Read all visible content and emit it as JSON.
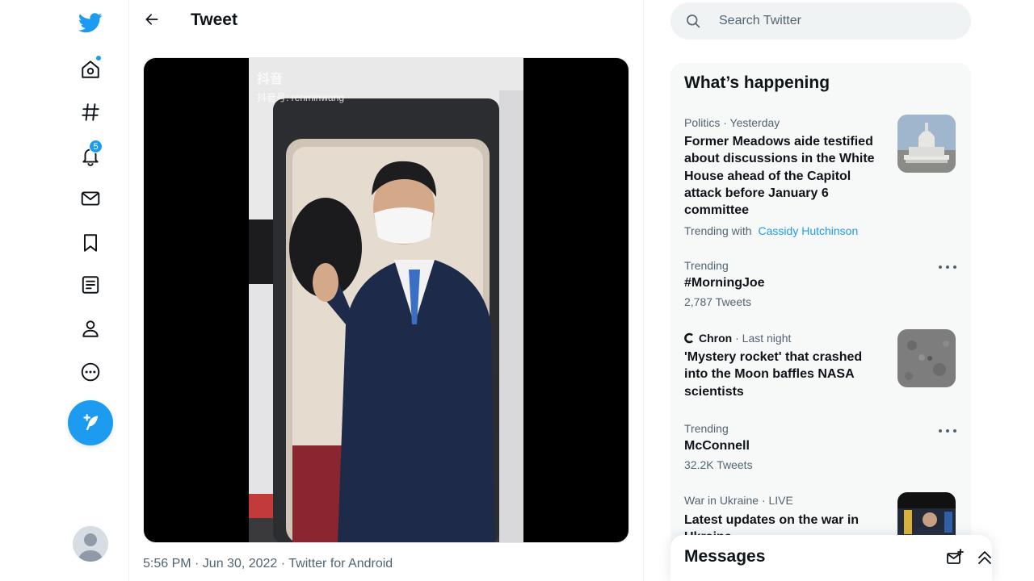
{
  "header": {
    "title": "Tweet"
  },
  "nav": {
    "notifications_badge": "5"
  },
  "tweet": {
    "video_watermark": "抖音",
    "video_watermark_id": "抖音号: renminwang",
    "meta": "5:56 PM · Jun 30, 2022 · Twitter for Android"
  },
  "search": {
    "placeholder": "Search Twitter"
  },
  "happening": {
    "title": "What’s happening",
    "trends": [
      {
        "meta": "Politics · Yesterday",
        "title": "Former Meadows aide testified about discussions in the White House ahead of the Capitol attack before January 6 committee",
        "sub": "Trending with",
        "link": "Cassidy Hutchinson"
      },
      {
        "meta": "Trending",
        "title": "#MorningJoe",
        "sub": "2,787 Tweets"
      },
      {
        "source": "Chron",
        "meta": "· Last night",
        "title": "'Mystery rocket' that crashed into the Moon baffles NASA scientists"
      },
      {
        "meta": "Trending",
        "title": "McConnell",
        "sub": "32.2K Tweets"
      },
      {
        "meta": "War in Ukraine · LIVE",
        "title": "Latest updates on the war in Ukraine"
      }
    ]
  },
  "messages": {
    "title": "Messages"
  },
  "colors": {
    "accent": "#1d9bf0",
    "text": "#0f1419",
    "secondary": "#536471"
  }
}
